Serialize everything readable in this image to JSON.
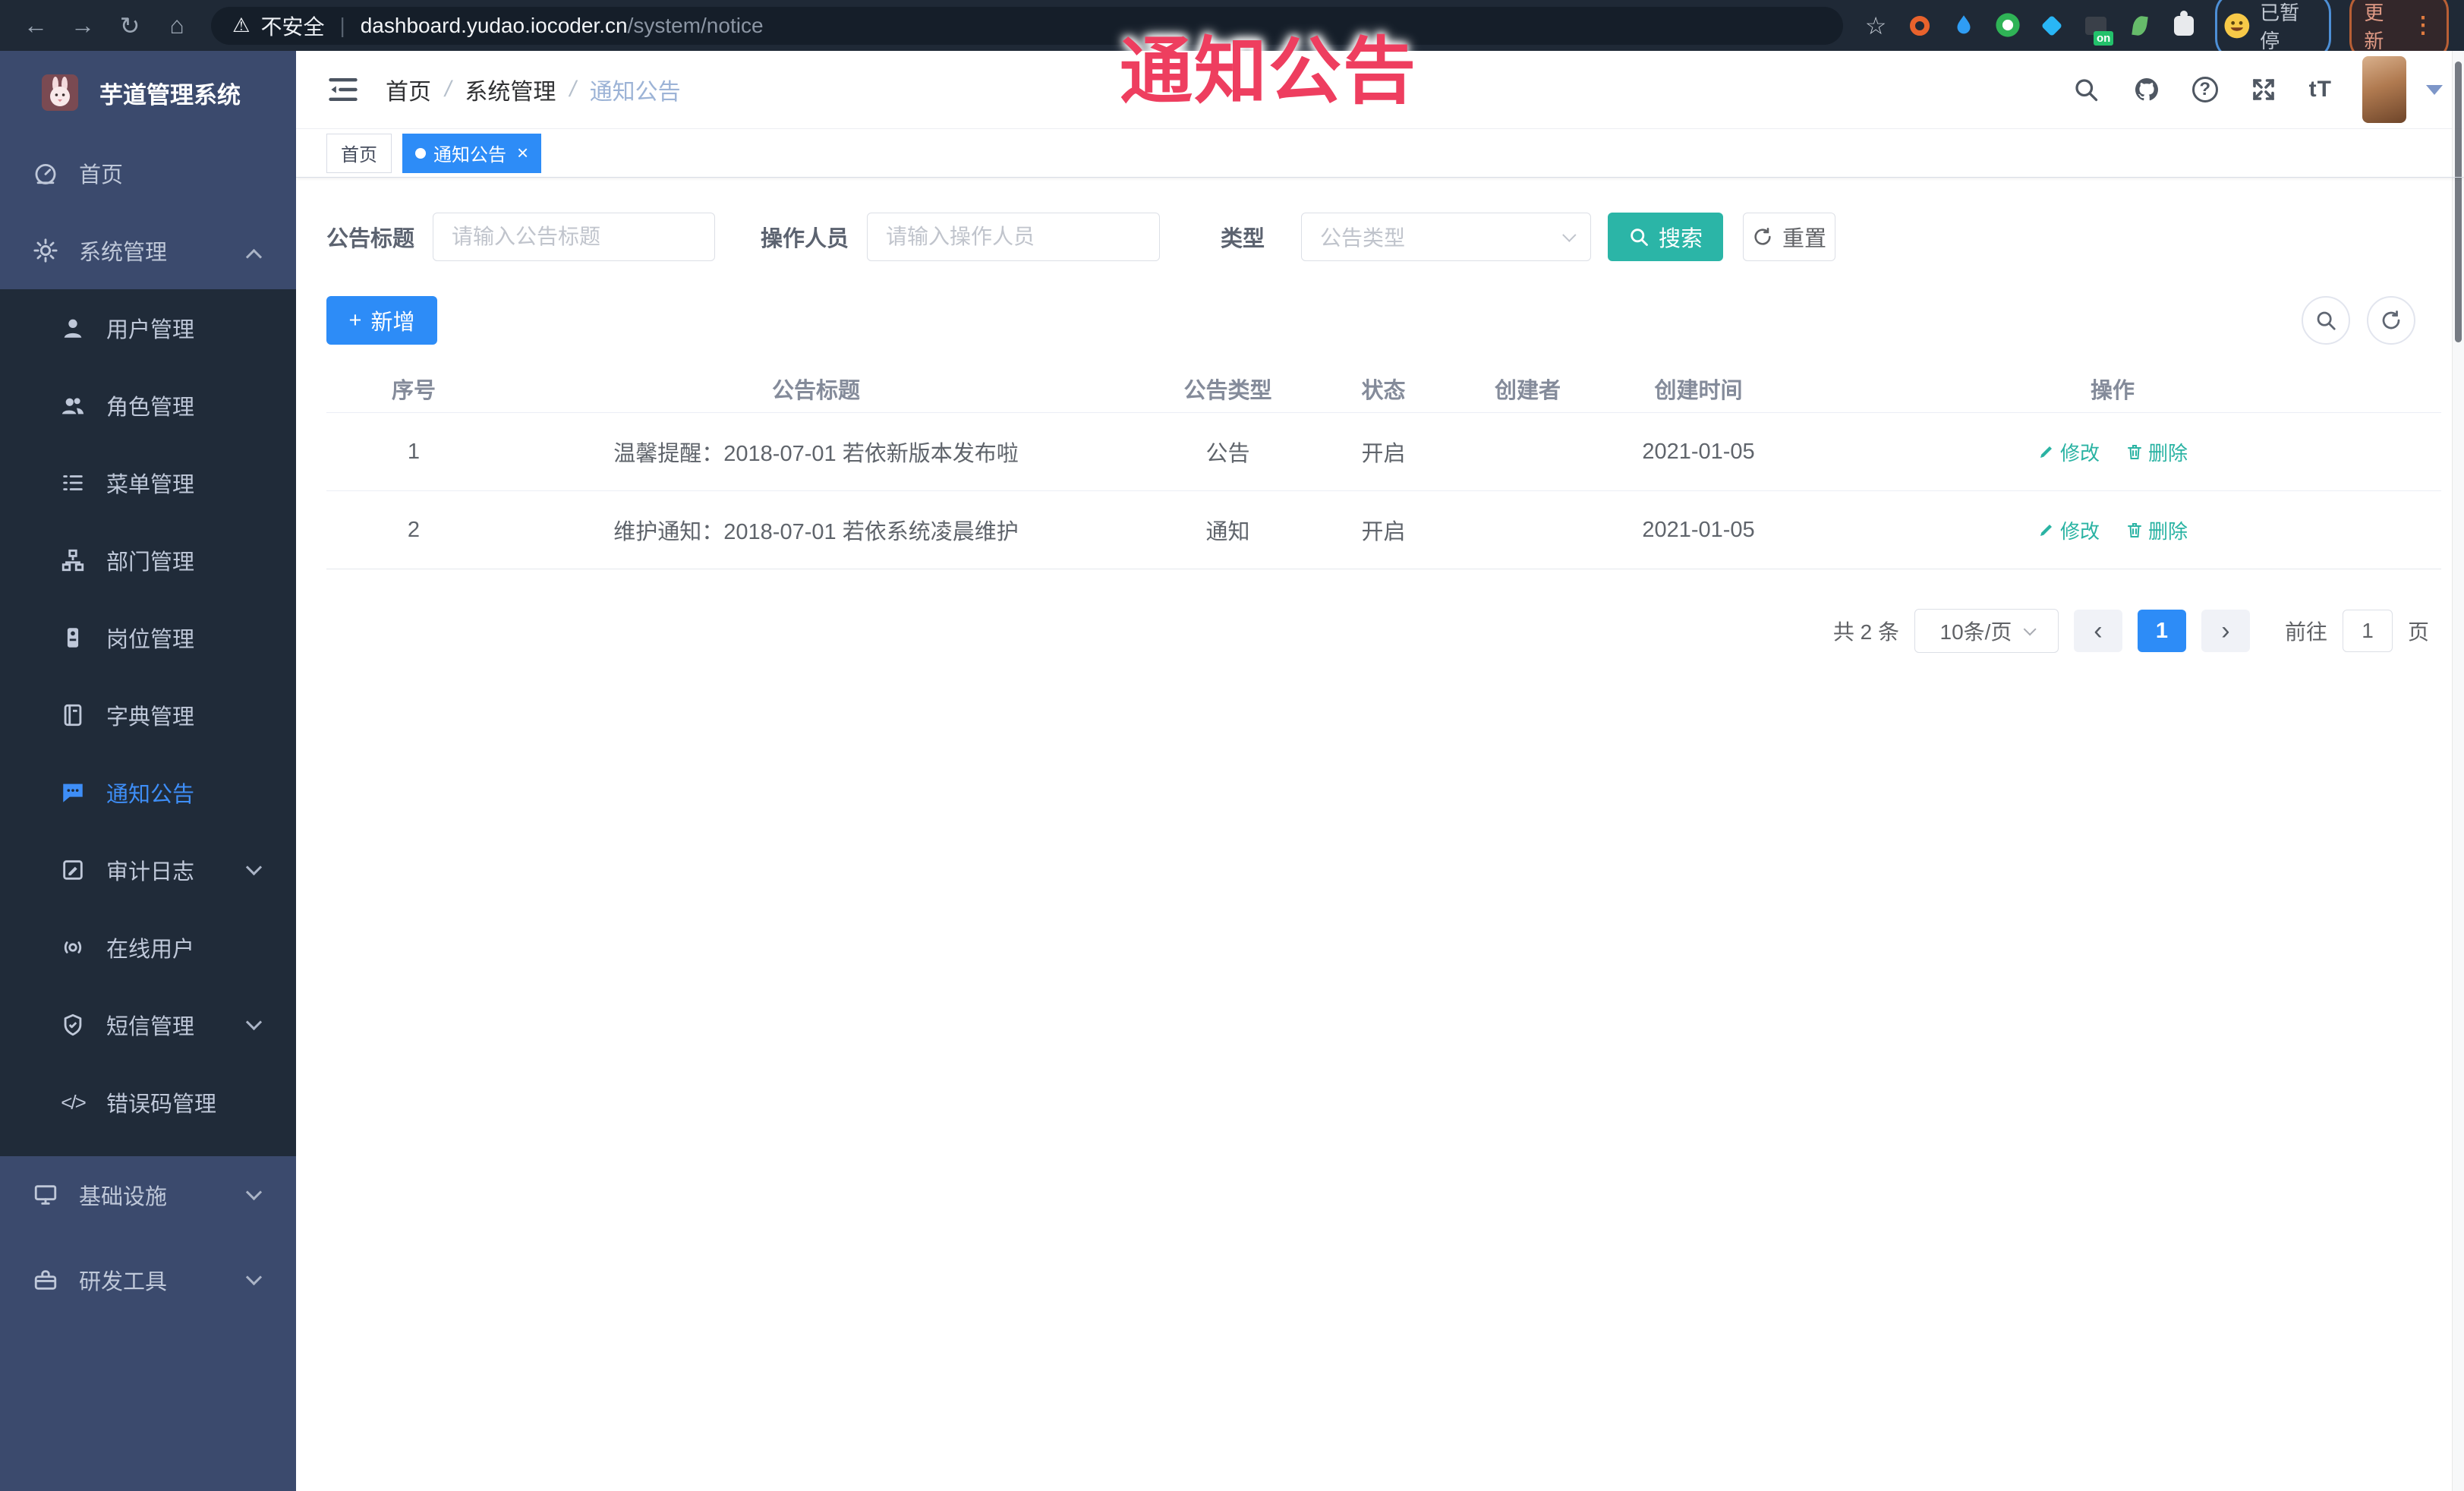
{
  "overlay": {
    "watermark": "通知公告"
  },
  "icons": {
    "back": "←",
    "forward": "→",
    "reload": "↻",
    "home": "⌂",
    "warning": "⚠",
    "divider": "|",
    "star": "☆",
    "kebab": "⋮",
    "close": "×",
    "plus": "+",
    "slash": "/",
    "chevron_left": "‹",
    "chevron_right": "›",
    "help": "?",
    "font_size": "tT",
    "code": "</>",
    "on_badge": "on"
  },
  "browser": {
    "security_label": "不安全",
    "url_host": "dashboard.yudao.iocoder.cn",
    "url_path": "/system/notice",
    "profile_status": "已暂停",
    "update_label": "更新"
  },
  "sidebar": {
    "app_title": "芋道管理系统",
    "items": [
      {
        "label": "首页",
        "icon": "dashboard",
        "level": "root"
      },
      {
        "label": "系统管理",
        "icon": "gear",
        "level": "root",
        "expanded": true
      },
      {
        "label": "用户管理",
        "icon": "user",
        "level": "sub"
      },
      {
        "label": "角色管理",
        "icon": "users",
        "level": "sub"
      },
      {
        "label": "菜单管理",
        "icon": "menu-list",
        "level": "sub"
      },
      {
        "label": "部门管理",
        "icon": "sitemap",
        "level": "sub"
      },
      {
        "label": "岗位管理",
        "icon": "id-badge",
        "level": "sub"
      },
      {
        "label": "字典管理",
        "icon": "book",
        "level": "sub"
      },
      {
        "label": "通知公告",
        "icon": "message",
        "level": "sub",
        "active": true
      },
      {
        "label": "审计日志",
        "icon": "log",
        "level": "sub",
        "collapsed": true
      },
      {
        "label": "在线用户",
        "icon": "online",
        "level": "sub"
      },
      {
        "label": "短信管理",
        "icon": "shield",
        "level": "sub",
        "collapsed": true
      },
      {
        "label": "错误码管理",
        "icon": "code",
        "level": "sub"
      },
      {
        "label": "基础设施",
        "icon": "monitor",
        "level": "root",
        "collapsed": true
      },
      {
        "label": "研发工具",
        "icon": "toolbox",
        "level": "root",
        "collapsed": true
      }
    ]
  },
  "header": {
    "breadcrumb": [
      "首页",
      "系统管理",
      "通知公告"
    ]
  },
  "tags": [
    {
      "label": "首页",
      "active": false
    },
    {
      "label": "通知公告",
      "active": true
    }
  ],
  "filters": {
    "title_label": "公告标题",
    "title_placeholder": "请输入公告标题",
    "operator_label": "操作人员",
    "operator_placeholder": "请输入操作人员",
    "type_label": "类型",
    "type_placeholder": "公告类型",
    "search_label": "搜索",
    "reset_label": "重置"
  },
  "toolbar": {
    "add_label": "新增"
  },
  "table": {
    "columns": [
      "序号",
      "公告标题",
      "公告类型",
      "状态",
      "创建者",
      "创建时间",
      "操作"
    ],
    "edit_label": "修改",
    "delete_label": "删除",
    "rows": [
      {
        "no": "1",
        "title": "温馨提醒：2018-07-01 若依新版本发布啦",
        "type": "公告",
        "status": "开启",
        "creator": "",
        "created_at": "2021-01-05"
      },
      {
        "no": "2",
        "title": "维护通知：2018-07-01 若依系统凌晨维护",
        "type": "通知",
        "status": "开启",
        "creator": "",
        "created_at": "2021-01-05"
      }
    ]
  },
  "pagination": {
    "total_text": "共 2 条",
    "page_size": "10条/页",
    "current_page": "1",
    "goto_label": "前往",
    "goto_value": "1",
    "page_unit": "页"
  },
  "colors": {
    "primary_blue": "#2d8cf7",
    "teal": "#2bb5a7",
    "watermark_red": "#ee3e5f",
    "sidebar_bg": "#3b4a6d",
    "submenu_bg": "#202b39",
    "chrome_bg": "#1f2936"
  }
}
